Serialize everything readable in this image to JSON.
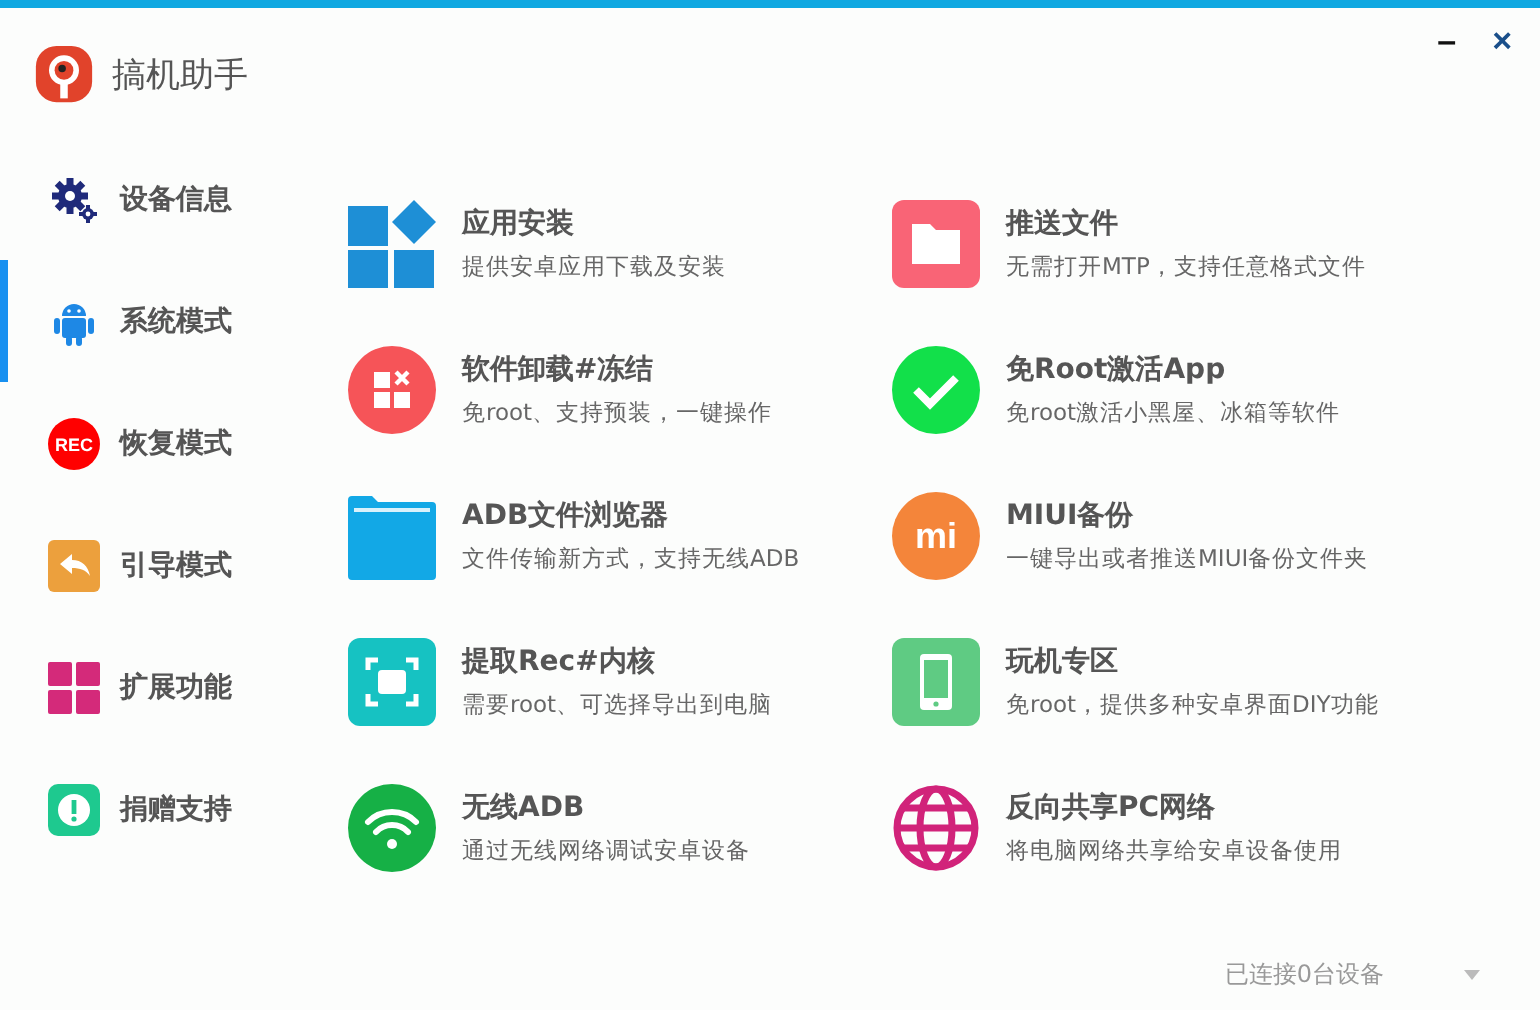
{
  "window": {
    "title": "搞机助手",
    "minimize": "–",
    "close": "×"
  },
  "sidebar": {
    "items": [
      {
        "label": "设备信息",
        "selected": false
      },
      {
        "label": "系统模式",
        "selected": true
      },
      {
        "label": "恢复模式",
        "icon_text": "REC",
        "selected": false
      },
      {
        "label": "引导模式",
        "selected": false
      },
      {
        "label": "扩展功能",
        "selected": false
      },
      {
        "label": "捐赠支持",
        "selected": false
      }
    ]
  },
  "features": [
    {
      "title": "应用安装",
      "description": "提供安卓应用下载及安装"
    },
    {
      "title": "推送文件",
      "description": "无需打开MTP，支持任意格式文件"
    },
    {
      "title": "软件卸载#冻结",
      "description": "免root、支持预装，一键操作"
    },
    {
      "title": "免Root激活App",
      "description": "免root激活小黑屋、冰箱等软件"
    },
    {
      "title": "ADB文件浏览器",
      "description": "文件传输新方式，支持无线ADB"
    },
    {
      "title": "MIUI备份",
      "description": "一键导出或者推送MIUI备份文件夹",
      "icon_text": "mi"
    },
    {
      "title": "提取Rec#内核",
      "description": "需要root、可选择导出到电脑"
    },
    {
      "title": "玩机专区",
      "description": "免root，提供多种安卓界面DIY功能"
    },
    {
      "title": "无线ADB",
      "description": "通过无线网络调试安卓设备"
    },
    {
      "title": "反向共享PC网络",
      "description": "将电脑网络共享给安卓设备使用"
    }
  ],
  "status_bar": {
    "device_status": "已连接0台设备"
  }
}
